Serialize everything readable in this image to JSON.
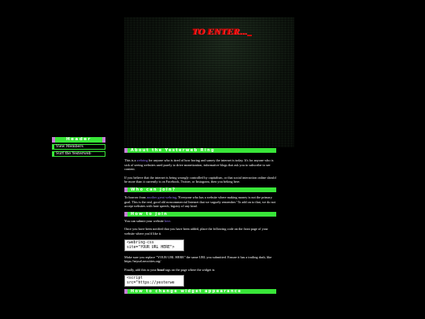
{
  "banner": {
    "enter_text": "TO ENTER..."
  },
  "sidebar": {
    "header": "Header",
    "links": [
      "View Members",
      "Surf the Yesterweb"
    ]
  },
  "sections": {
    "about": {
      "title": "About the Yesterweb Ring",
      "p1_a": "This is a ",
      "p1_link": "webring",
      "p1_b": " for anyone who is tired of how boring and samey the internet is today. It's for anyone who is sick of seeing websites used purely to drive monetization, informative blogs that ask you to subscribe to see content.",
      "p2": "If you believe that the internet is being wrongly controlled by capitalism, or that social interaction online should be more than it currently is on Facebook, Twitter, or Instagram, then you belong here."
    },
    "who": {
      "title": "Who can join?",
      "p_a": "To borrow from ",
      "p_link": "another great webring",
      "p_b": ", 'Everyone who has a website where making money is not the primary goal. This is the real, good old noncommercial Internet that we vaguely remember.' To add on to that, we do not accept websites with hate speech, bigotry of any kind."
    },
    "how": {
      "title": "How to join",
      "p1_a": "You can submit your website ",
      "p1_link": "here",
      "p1_b": ".",
      "p2": "Once you have been notified that you have been added, place the following code on the front page of your website where you'd like it.",
      "code1": "<webring-css\nsite=\"YOUR URL HERE\">",
      "p3": "Make sure you replace \"YOUR URL HERE\" the same URL you submitted. Ensure it has a trailing dash, like https://myurl.neocities.org/",
      "p4_a": "Finally, add this to your ",
      "p4_bold": "head",
      "p4_b": " tags on the page where the widget is:",
      "code2": "<script\nsrc=\"https://yesterwe"
    },
    "change": {
      "title": "How to change widget appearance"
    }
  },
  "colors": {
    "accent": "#39e639",
    "accent_edge": "#c77dd8",
    "link": "#9a7cff",
    "alert": "#e00000"
  }
}
